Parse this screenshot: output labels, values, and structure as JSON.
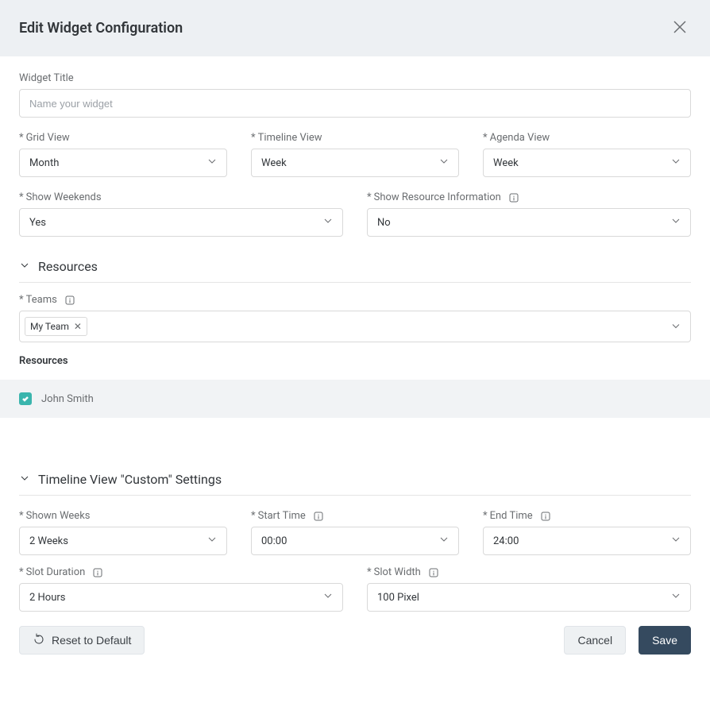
{
  "header": {
    "title": "Edit Widget Configuration"
  },
  "form": {
    "widget_title": {
      "label": "Widget Title",
      "placeholder": "Name your widget",
      "value": ""
    },
    "grid_view": {
      "label": "Grid View",
      "value": "Month"
    },
    "timeline_view": {
      "label": "Timeline View",
      "value": "Week"
    },
    "agenda_view": {
      "label": "Agenda View",
      "value": "Week"
    },
    "show_weekends": {
      "label": "Show Weekends",
      "value": "Yes"
    },
    "show_resource_info": {
      "label": "Show Resource Information",
      "value": "No"
    }
  },
  "sections": {
    "resources": {
      "title": "Resources",
      "teams_label": "Teams",
      "teams_chip": "My Team",
      "resources_subtitle": "Resources",
      "items": [
        {
          "name": "John Smith",
          "checked": true
        }
      ]
    },
    "timeline_custom": {
      "title": "Timeline View \"Custom\" Settings",
      "shown_weeks": {
        "label": "Shown Weeks",
        "value": "2 Weeks"
      },
      "start_time": {
        "label": "Start Time",
        "value": "00:00"
      },
      "end_time": {
        "label": "End Time",
        "value": "24:00"
      },
      "slot_duration": {
        "label": "Slot Duration",
        "value": "2 Hours"
      },
      "slot_width": {
        "label": "Slot Width",
        "value": "100 Pixel"
      }
    }
  },
  "footer": {
    "reset": "Reset to Default",
    "cancel": "Cancel",
    "save": "Save"
  }
}
